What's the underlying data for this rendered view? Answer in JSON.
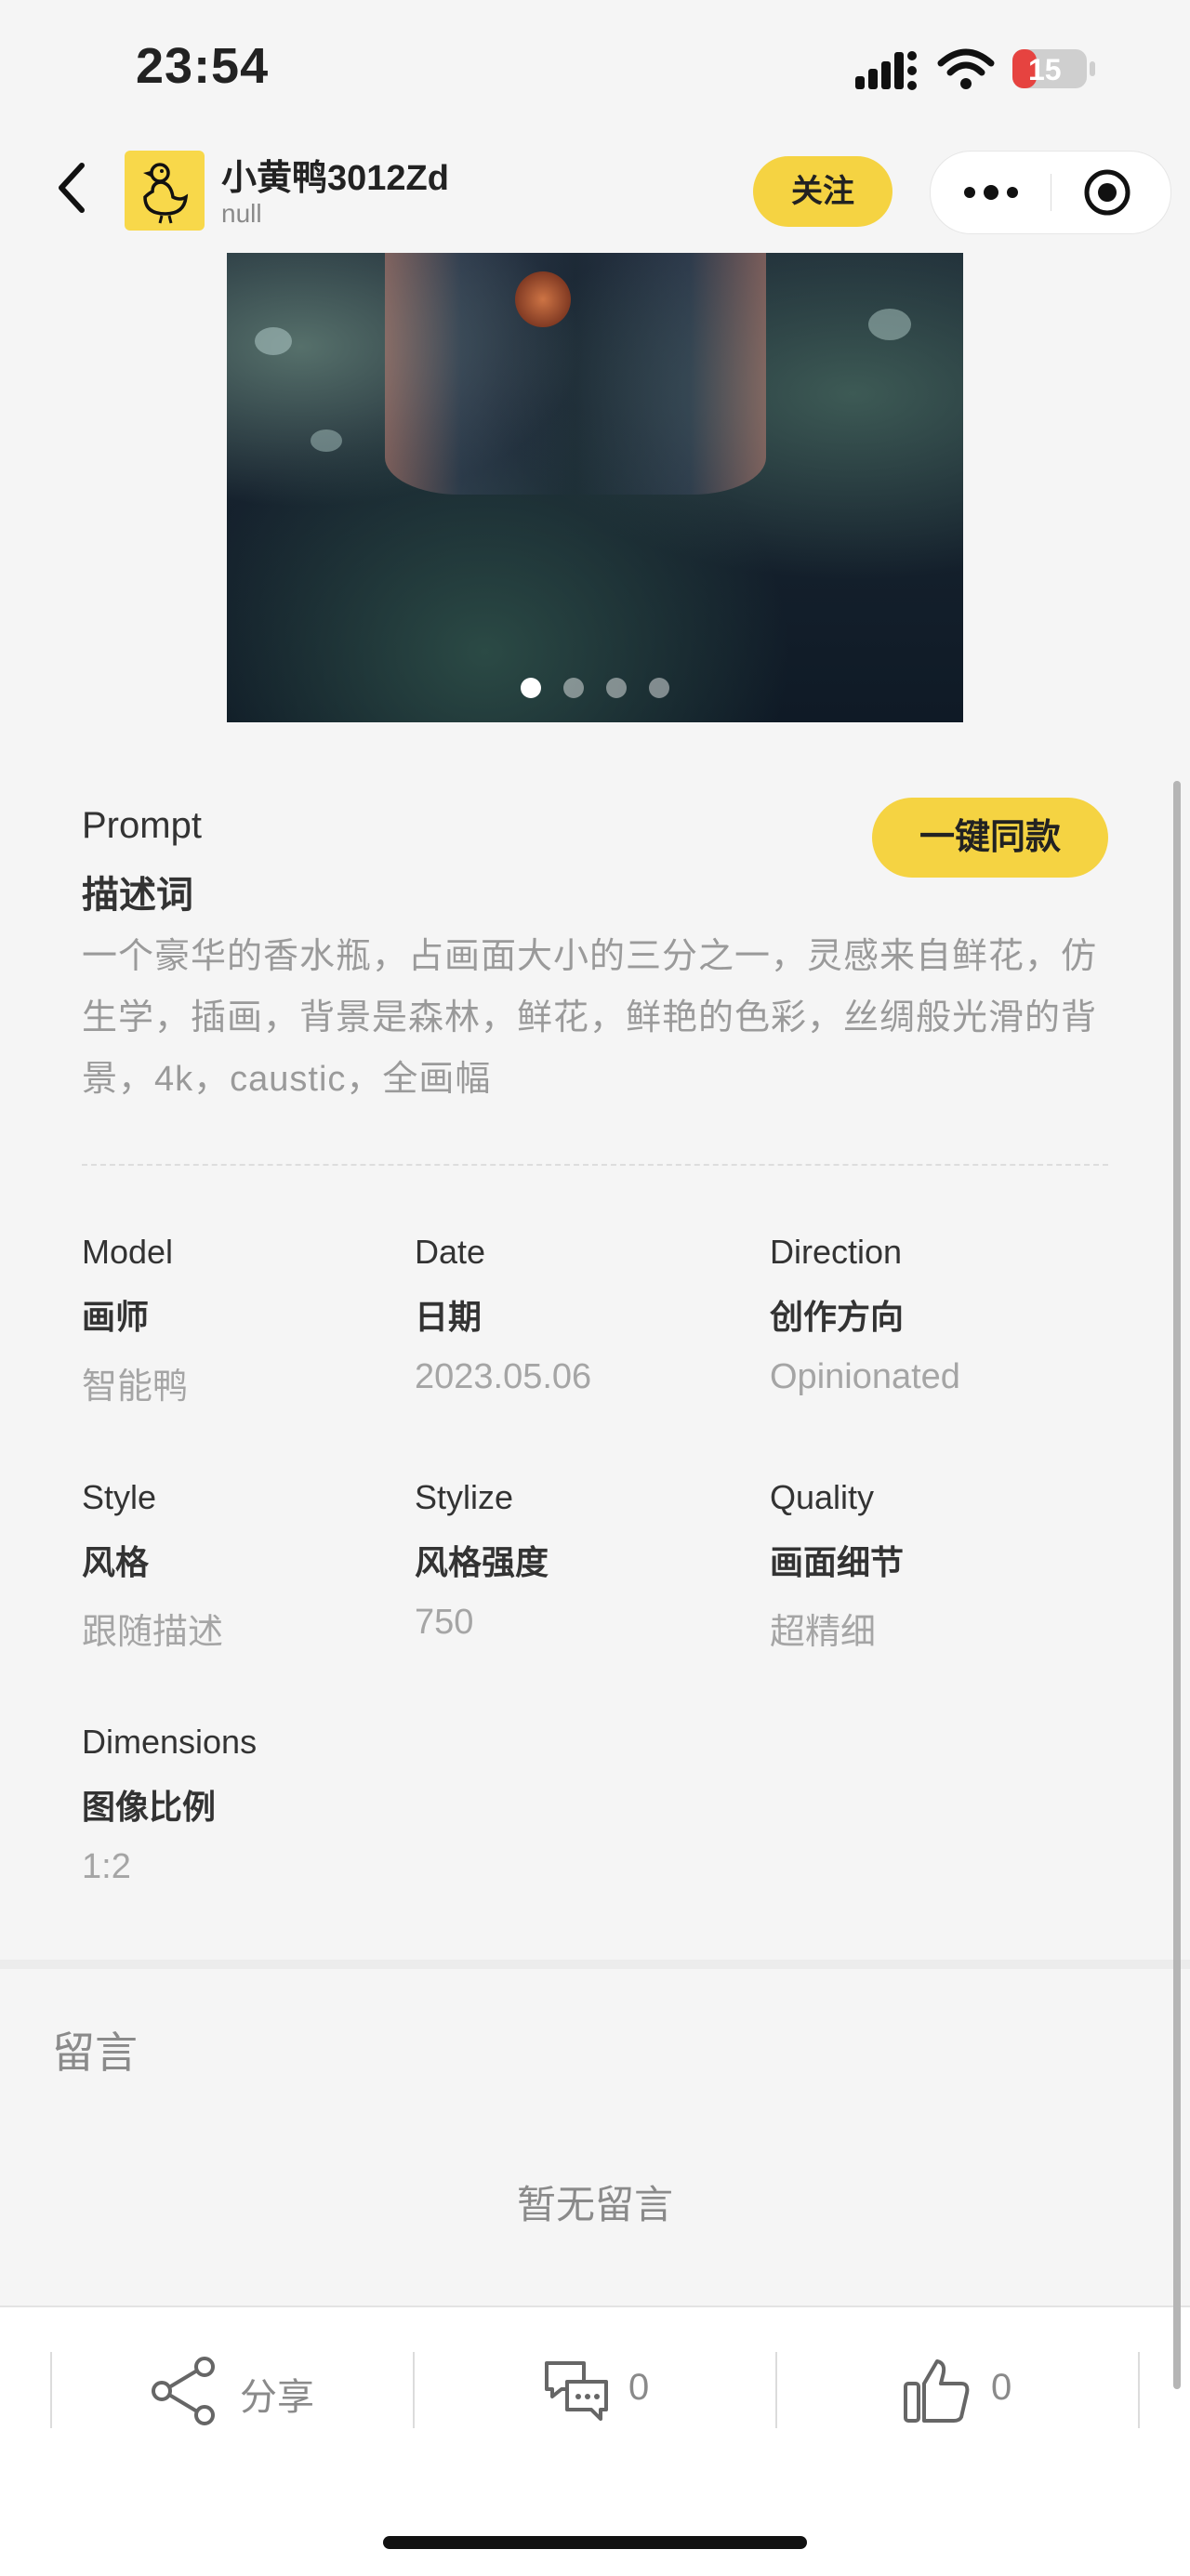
{
  "status_bar": {
    "time": "23:54",
    "battery": "15"
  },
  "author": {
    "name": "小黄鸭3012Zd",
    "subtitle": "null",
    "follow_label": "关注"
  },
  "image": {
    "page_count": 4,
    "current_page": 1
  },
  "prompt": {
    "title_en": "Prompt",
    "title_zh": "描述词",
    "copy_button": "一键同款",
    "text": "一个豪华的香水瓶，占画面大小的三分之一，灵感来自鲜花，仿生学，插画，背景是森林，鲜花，鲜艳的色彩，丝绸般光滑的背景，4k，caustic，全画幅"
  },
  "params": {
    "model": {
      "en": "Model",
      "zh": "画师",
      "value": "智能鸭"
    },
    "date": {
      "en": "Date",
      "zh": "日期",
      "value": "2023.05.06"
    },
    "direction": {
      "en": "Direction",
      "zh": "创作方向",
      "value": "Opinionated"
    },
    "style": {
      "en": "Style",
      "zh": "风格",
      "value": "跟随描述"
    },
    "stylize": {
      "en": "Stylize",
      "zh": "风格强度",
      "value": "750"
    },
    "quality": {
      "en": "Quality",
      "zh": "画面细节",
      "value": "超精细"
    },
    "dimensions": {
      "en": "Dimensions",
      "zh": "图像比例",
      "value": "1:2"
    }
  },
  "comments": {
    "title": "留言",
    "empty_text": "暂无留言"
  },
  "bottom_bar": {
    "share_label": "分享",
    "comment_count": "0",
    "like_count": "0"
  },
  "colors": {
    "accent": "#f5d342",
    "background": "#f5f5f5"
  }
}
